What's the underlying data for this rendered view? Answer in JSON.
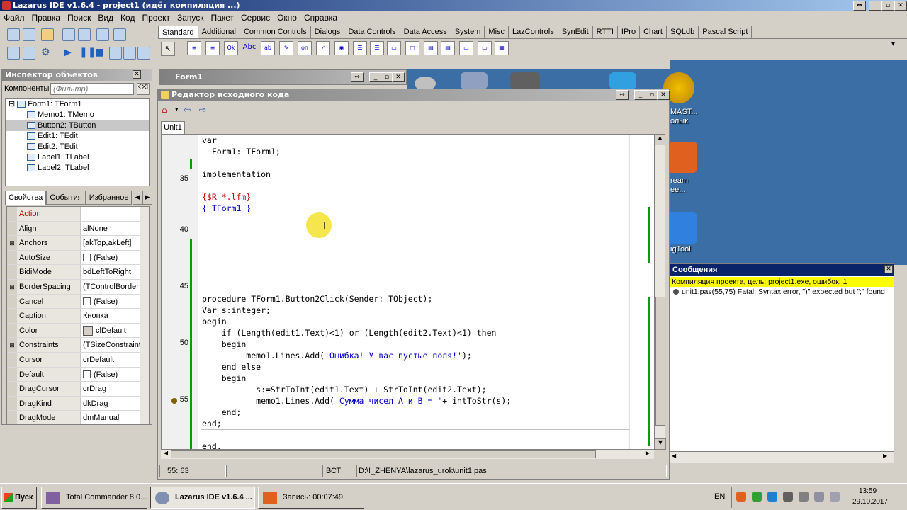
{
  "window": {
    "title": "Lazarus IDE v1.6.4 - project1 (идёт компиляция ...)"
  },
  "menu": [
    "Файл",
    "Правка",
    "Поиск",
    "Вид",
    "Код",
    "Проект",
    "Запуск",
    "Пакет",
    "Сервис",
    "Окно",
    "Справка"
  ],
  "palette_tabs": [
    "Standard",
    "Additional",
    "Common Controls",
    "Dialogs",
    "Data Controls",
    "Data Access",
    "System",
    "Misc",
    "LazControls",
    "SynEdit",
    "RTTI",
    "IPro",
    "Chart",
    "SQLdb",
    "Pascal Script"
  ],
  "inspector": {
    "title": "Инспектор объектов",
    "components_label": "Компоненты",
    "filter_placeholder": "(Фильтр)",
    "tree": [
      "Form1: TForm1",
      "Memo1: TMemo",
      "Button2: TButton",
      "Edit1: TEdit",
      "Edit2: TEdit",
      "Label1: TLabel",
      "Label2: TLabel"
    ],
    "tabs": [
      "Свойства",
      "События",
      "Избранное"
    ],
    "props": [
      {
        "k": "Action",
        "v": ""
      },
      {
        "k": "Align",
        "v": "alNone"
      },
      {
        "k": "Anchors",
        "v": "[akTop,akLeft]"
      },
      {
        "k": "AutoSize",
        "v": "(False)"
      },
      {
        "k": "BidiMode",
        "v": "bdLeftToRight"
      },
      {
        "k": "BorderSpacing",
        "v": "(TControlBorderSpacing)"
      },
      {
        "k": "Cancel",
        "v": "(False)"
      },
      {
        "k": "Caption",
        "v": "Кнопка"
      },
      {
        "k": "Color",
        "v": "clDefault"
      },
      {
        "k": "Constraints",
        "v": "(TSizeConstraints)"
      },
      {
        "k": "Cursor",
        "v": "crDefault"
      },
      {
        "k": "Default",
        "v": "(False)"
      },
      {
        "k": "DragCursor",
        "v": "crDrag"
      },
      {
        "k": "DragKind",
        "v": "dkDrag"
      },
      {
        "k": "DragMode",
        "v": "dmManual"
      }
    ]
  },
  "form1": {
    "title": "Form1"
  },
  "editor": {
    "title": "Редактор исходного кода",
    "tab": "Unit1",
    "line_numbers": {
      "n35": "35",
      "n40": "40",
      "n45": "45",
      "n50": "50",
      "n55": "55"
    },
    "code": {
      "l1": "var",
      "l2": "  Form1: TForm1;",
      "l3": "implementation",
      "l4": "{$R *.lfm}",
      "l5": "{ TForm1 }",
      "l6a": "procedure TForm1.Button2Click(Sender: TObject);",
      "l7": "Var s:integer;",
      "l8": "begin",
      "l9": "    if (Length(edit1.Text)<1) or (Length(edit2.Text)<1) then",
      "l10": "    begin",
      "l11a": "         memo1.Lines.Add(",
      "l11b": "'Ошибка! У вас пустые поля!'",
      "l11c": ");",
      "l12": "    end else",
      "l13": "    begin",
      "l14": "           s:=StrToInt(edit1.Text) + StrToInt(edit2.Text);",
      "l15a": "           memo1.Lines.Add(",
      "l15b": "'Сумма чисел A и B = '",
      "l15c": "+ intToStr(s);",
      "l16": "    end;",
      "l17": "end;",
      "l18": "end."
    },
    "status": {
      "pos": "55: 63",
      "mode": "ВСТ",
      "path": "D:\\!_ZHENYA\\lazarus_urok\\unit1.pas"
    }
  },
  "messages": {
    "title": "Сообщения",
    "line1": "Компиляция проекта, цель: project1.exe, ошибок: 1",
    "line2": "unit1.pas(55,75) Fatal: Syntax error, \")\" expected but \";\" found"
  },
  "desktop": {
    "labels": [
      "MAST...",
      "олык",
      "ream",
      "ee...",
      "igTool"
    ]
  },
  "taskbar": {
    "start": "Пуск",
    "tasks": [
      "Total Commander 8.0...",
      "Lazarus IDE v1.6.4 ...",
      "Запись:  00:07:49"
    ],
    "lang": "EN",
    "time": "13:59",
    "date": "29.10.2017"
  },
  "colors": {
    "accent": "#0a246a",
    "selection": "#ffff00",
    "code_string": "#0000c0",
    "directive": "#c00000",
    "modified_bar": "#00a000"
  }
}
